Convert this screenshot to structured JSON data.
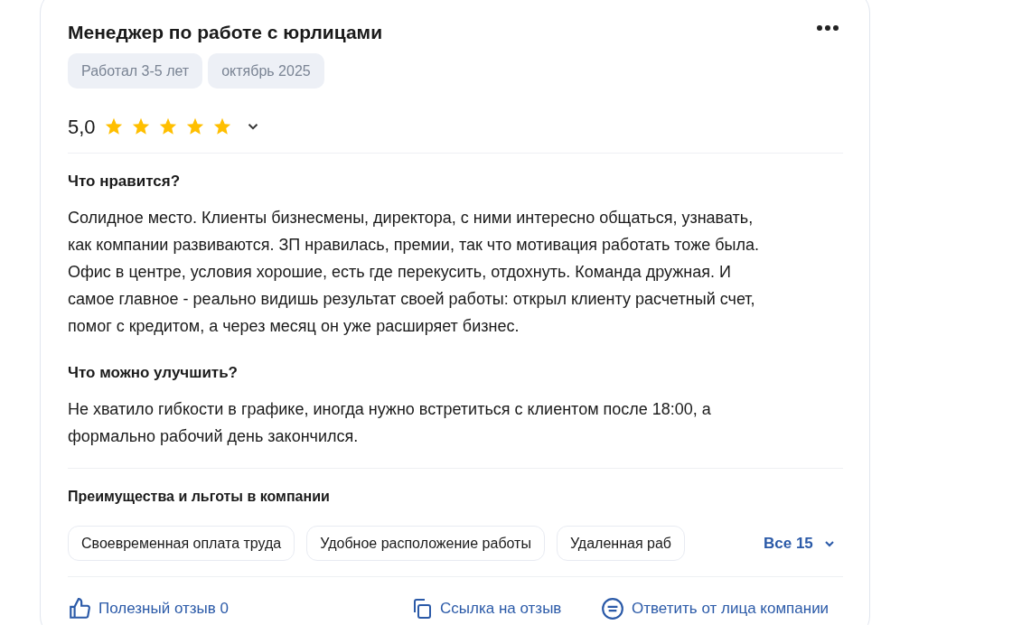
{
  "review": {
    "title": "Менеджер по работе с юрлицами",
    "tags": [
      "Работал 3-5 лет",
      "октябрь 2025"
    ],
    "rating": {
      "value": "5,0",
      "stars": 5
    },
    "sections": [
      {
        "heading": "Что нравится?",
        "text": "Солидное место. Клиенты бизнесмены, директора, с ними интересно общаться, узнавать, как компании развиваются. ЗП нравилась, премии, так что мотивация работать тоже была. Офис в центре, условия хорошие, есть где перекусить, отдохнуть. Команда дружная. И самое главное - реально видишь результат своей работы: открыл клиенту расчетный счет, помог с кредитом, а через месяц он уже расширяет бизнес."
      },
      {
        "heading": "Что можно улучшить?",
        "text": "Не хватило гибкости в графике, иногда нужно встретиться с клиентом после 18:00, а формально рабочий день закончился."
      }
    ],
    "benefits": {
      "heading": "Преимущества и льготы в компании",
      "items": [
        "Своевременная оплата труда",
        "Удобное расположение работы",
        "Удаленная раб"
      ],
      "more": "Все 15"
    },
    "actions": [
      {
        "kind": "like",
        "label": "Полезный отзыв 0"
      },
      {
        "kind": "link",
        "label": "Ссылка на отзыв"
      },
      {
        "kind": "reply",
        "label": "Ответить от лица компании"
      }
    ]
  }
}
